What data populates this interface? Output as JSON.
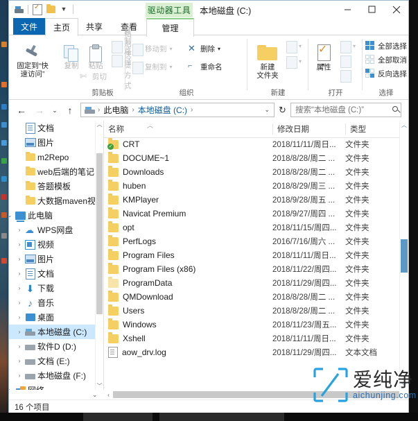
{
  "window": {
    "context_tab": "驱动器工具",
    "title": "本地磁盘 (C:)",
    "minimize": "—",
    "maximize": "□",
    "close": "✕"
  },
  "quick_access_toolbar": {
    "items": [
      {
        "name": "drive-icon",
        "label": "驱动器"
      },
      {
        "name": "properties-icon",
        "label": "属性"
      },
      {
        "name": "new-folder-icon",
        "label": "新建文件夹"
      },
      {
        "name": "customize-dropdown",
        "label": "▼"
      }
    ]
  },
  "tabs": [
    {
      "label": "文件",
      "state": "file"
    },
    {
      "label": "主页",
      "state": "active"
    },
    {
      "label": "共享",
      "state": "normal"
    },
    {
      "label": "查看",
      "state": "normal"
    },
    {
      "label": "管理",
      "state": "contextual"
    }
  ],
  "ribbon_help": {
    "collapse": "︿",
    "help": "?"
  },
  "ribbon": {
    "groups": [
      {
        "name": "clipboard",
        "label": "剪贴板",
        "big_buttons": [
          {
            "name": "pin-to-quick-access",
            "line1": "固定到“快",
            "line2": "速访问”",
            "icon": "pin-icon",
            "dim": false
          },
          {
            "name": "copy",
            "line1": "复制",
            "line2": "",
            "icon": "copy-icon",
            "dim": true
          },
          {
            "name": "paste",
            "line1": "粘贴",
            "line2": "",
            "icon": "paste-icon",
            "dim": true
          }
        ],
        "small_buttons": [
          {
            "name": "copy-path",
            "label": "复制路径",
            "dim": true
          },
          {
            "name": "paste-shortcut",
            "label": "粘贴快捷方式",
            "dim": true
          },
          {
            "name": "cut",
            "label": "剪切",
            "dim": true
          }
        ]
      },
      {
        "name": "organize",
        "label": "组织",
        "small_buttons": [
          {
            "name": "move-to",
            "label": "移动到",
            "caret": "▾",
            "dim": true
          },
          {
            "name": "copy-to",
            "label": "复制到",
            "caret": "▾",
            "dim": true
          },
          {
            "name": "delete",
            "label": "删除",
            "caret": "▾",
            "dim": false
          },
          {
            "name": "rename",
            "label": "重命名",
            "caret": "",
            "dim": false
          }
        ]
      },
      {
        "name": "new",
        "label": "新建",
        "big_buttons": [
          {
            "name": "new-folder",
            "line1": "新建",
            "line2": "文件夹",
            "icon": "new-folder-icon",
            "dim": false
          }
        ],
        "small_buttons": [
          {
            "name": "new-item",
            "label": "",
            "caret": "▾",
            "dim": true
          },
          {
            "name": "easy-access",
            "label": "",
            "caret": "▾",
            "dim": true
          }
        ]
      },
      {
        "name": "open",
        "label": "打开",
        "big_buttons": [
          {
            "name": "properties",
            "line1": "属性",
            "line2": "",
            "icon": "properties-icon",
            "dim": false
          }
        ],
        "small_buttons": [
          {
            "name": "open-with",
            "label": "",
            "caret": "▾",
            "dim": true
          },
          {
            "name": "edit",
            "label": "",
            "caret": "",
            "dim": true
          },
          {
            "name": "history",
            "label": "",
            "caret": "",
            "dim": true
          }
        ]
      },
      {
        "name": "select",
        "label": "选择",
        "small_buttons": [
          {
            "name": "select-all",
            "label": "全部选择",
            "dim": false
          },
          {
            "name": "select-none",
            "label": "全部取消",
            "dim": false
          },
          {
            "name": "invert-selection",
            "label": "反向选择",
            "dim": false
          }
        ]
      }
    ]
  },
  "address_bar": {
    "back": "←",
    "forward": "→",
    "recent": "⌄",
    "up": "↑",
    "breadcrumb": [
      {
        "label": "此电脑",
        "current": false
      },
      {
        "label": "本地磁盘 (C:)",
        "current": true
      }
    ],
    "breadcrumb_dropdown": "⌄",
    "refresh": "↻",
    "search_placeholder": "搜索“本地磁盘 (C:)”",
    "search_value": ""
  },
  "nav_pane": {
    "items": [
      {
        "label": "文档",
        "icon": "document-icon",
        "indent": 1,
        "expander": "",
        "pinned": true,
        "selected": false
      },
      {
        "label": "图片",
        "icon": "pictures-icon",
        "indent": 1,
        "expander": "",
        "pinned": true,
        "selected": false
      },
      {
        "label": "m2Repo",
        "icon": "folder-icon",
        "indent": 1,
        "expander": "",
        "pinned": false,
        "selected": false
      },
      {
        "label": "web后端的笔记",
        "icon": "folder-icon",
        "indent": 1,
        "expander": "",
        "pinned": false,
        "selected": false
      },
      {
        "label": "答题模板",
        "icon": "folder-icon",
        "indent": 1,
        "expander": "",
        "pinned": false,
        "selected": false
      },
      {
        "label": "大数据maven视",
        "icon": "folder-icon",
        "indent": 1,
        "expander": "",
        "pinned": false,
        "selected": false
      },
      {
        "label": "此电脑",
        "icon": "this-pc-icon",
        "indent": 0,
        "expander": "⌄",
        "pinned": false,
        "selected": false
      },
      {
        "label": "WPS网盘",
        "icon": "cloud-icon",
        "indent": 1,
        "expander": "›",
        "pinned": false,
        "selected": false
      },
      {
        "label": "视频",
        "icon": "video-icon",
        "indent": 1,
        "expander": "›",
        "pinned": false,
        "selected": false
      },
      {
        "label": "图片",
        "icon": "pictures-icon",
        "indent": 1,
        "expander": "›",
        "pinned": false,
        "selected": false
      },
      {
        "label": "文档",
        "icon": "document-icon",
        "indent": 1,
        "expander": "›",
        "pinned": false,
        "selected": false
      },
      {
        "label": "下载",
        "icon": "downloads-icon",
        "indent": 1,
        "expander": "›",
        "pinned": false,
        "selected": false
      },
      {
        "label": "音乐",
        "icon": "music-icon",
        "indent": 1,
        "expander": "›",
        "pinned": false,
        "selected": false
      },
      {
        "label": "桌面",
        "icon": "desktop-icon",
        "indent": 1,
        "expander": "›",
        "pinned": false,
        "selected": false
      },
      {
        "label": "本地磁盘 (C:)",
        "icon": "hdd-system-icon",
        "indent": 1,
        "expander": "›",
        "pinned": false,
        "selected": true
      },
      {
        "label": "软件D (D:)",
        "icon": "hdd-icon",
        "indent": 1,
        "expander": "›",
        "pinned": false,
        "selected": false
      },
      {
        "label": "文档 (E:)",
        "icon": "hdd-icon",
        "indent": 1,
        "expander": "›",
        "pinned": false,
        "selected": false
      },
      {
        "label": "本地磁盘 (F:)",
        "icon": "hdd-icon",
        "indent": 1,
        "expander": "›",
        "pinned": false,
        "selected": false
      },
      {
        "label": "网络",
        "icon": "network-icon",
        "indent": 0,
        "expander": "›",
        "pinned": false,
        "selected": false
      }
    ],
    "scroll_up": "︿",
    "scroll_down": "﹀"
  },
  "file_list": {
    "columns": [
      {
        "key": "name",
        "label": "名称",
        "sorted": true,
        "sort_dir": "asc"
      },
      {
        "key": "date",
        "label": "修改日期",
        "sorted": false
      },
      {
        "key": "type",
        "label": "类型",
        "sorted": false
      }
    ],
    "rows": [
      {
        "name": "CRT",
        "date": "2018/11/11/周日...",
        "type": "文件夹",
        "icon": "folder-icon",
        "overlay": "sync-ok"
      },
      {
        "name": "DOCUME~1",
        "date": "2018/8/28/周二 ...",
        "type": "文件夹",
        "icon": "folder-icon",
        "overlay": ""
      },
      {
        "name": "Downloads",
        "date": "2018/8/28/周二 ...",
        "type": "文件夹",
        "icon": "folder-icon",
        "overlay": ""
      },
      {
        "name": "huben",
        "date": "2018/8/29/周三 ...",
        "type": "文件夹",
        "icon": "folder-icon",
        "overlay": ""
      },
      {
        "name": "KMPlayer",
        "date": "2018/9/28/周五 ...",
        "type": "文件夹",
        "icon": "folder-icon",
        "overlay": ""
      },
      {
        "name": "Navicat Premium",
        "date": "2018/9/27/周四 ...",
        "type": "文件夹",
        "icon": "folder-icon",
        "overlay": ""
      },
      {
        "name": "opt",
        "date": "2018/11/15/周四...",
        "type": "文件夹",
        "icon": "folder-icon",
        "overlay": ""
      },
      {
        "name": "PerfLogs",
        "date": "2016/7/16/周六 ...",
        "type": "文件夹",
        "icon": "folder-icon",
        "overlay": ""
      },
      {
        "name": "Program Files",
        "date": "2018/11/11/周日...",
        "type": "文件夹",
        "icon": "folder-icon",
        "overlay": ""
      },
      {
        "name": "Program Files (x86)",
        "date": "2018/11/22/周四...",
        "type": "文件夹",
        "icon": "folder-icon",
        "overlay": ""
      },
      {
        "name": "ProgramData",
        "date": "2018/11/29/周四...",
        "type": "文件夹",
        "icon": "folder-icon-pale",
        "overlay": ""
      },
      {
        "name": "QMDownload",
        "date": "2018/8/28/周二 ...",
        "type": "文件夹",
        "icon": "folder-icon",
        "overlay": ""
      },
      {
        "name": "Users",
        "date": "2018/8/28/周二 ...",
        "type": "文件夹",
        "icon": "folder-icon",
        "overlay": ""
      },
      {
        "name": "Windows",
        "date": "2018/11/23/周五...",
        "type": "文件夹",
        "icon": "folder-icon",
        "overlay": ""
      },
      {
        "name": "Xshell",
        "date": "2018/11/11/周日...",
        "type": "文件夹",
        "icon": "folder-icon",
        "overlay": ""
      },
      {
        "name": "aow_drv.log",
        "date": "2018/11/29/周四...",
        "type": "文本文档",
        "icon": "text-file-icon",
        "overlay": ""
      }
    ]
  },
  "status_bar": {
    "item_count": "16 个项目"
  },
  "watermark": {
    "cn": "爱纯净",
    "en": "aichunjing.com",
    "logo_color": "#29a3e0",
    "text_color": "#2b6fb0"
  },
  "colors": {
    "accent": "#0b67b2",
    "selection": "#cce8ff",
    "contextual_tab": "#d9f0d3",
    "contextual_tab_text": "#1d6b2a",
    "folder": "#f6cf63",
    "scrollbar_thumb": "#5d97c4"
  }
}
